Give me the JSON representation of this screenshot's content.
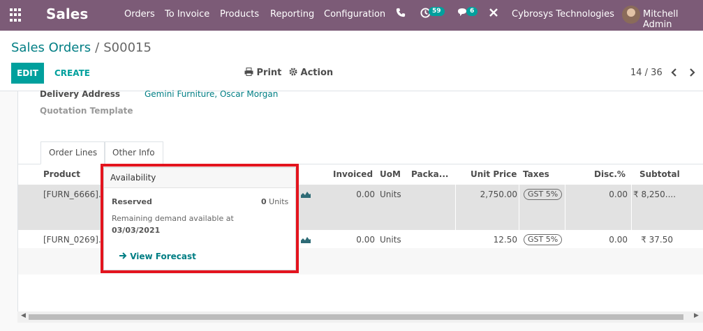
{
  "navbar": {
    "app_name": "Sales",
    "menu": [
      "Orders",
      "To Invoice",
      "Products",
      "Reporting",
      "Configuration"
    ],
    "activity_count": "59",
    "messages_count": "6",
    "company": "Cybrosys Technologies",
    "user": "Mitchell Admin"
  },
  "breadcrumb": {
    "parent": "Sales Orders",
    "separator": "/",
    "current": "S00015"
  },
  "toolbar": {
    "edit": "EDIT",
    "create": "CREATE",
    "print": "Print",
    "action": "Action",
    "pager": "14 / 36"
  },
  "form": {
    "delivery_address_label": "Delivery Address",
    "delivery_address_value": "Gemini Furniture, Oscar Morgan",
    "quotation_template_label": "Quotation Template"
  },
  "tabs": [
    "Order Lines",
    "Other Info"
  ],
  "table": {
    "columns": {
      "product": "Product",
      "invoiced": "Invoiced",
      "uom": "UoM",
      "packaging": "Packa...",
      "unit_price": "Unit Price",
      "taxes": "Taxes",
      "discount": "Disc.%",
      "subtotal": "Subtotal"
    },
    "rows": [
      {
        "product": "[FURN_6666]...",
        "invoiced": "0.00",
        "uom": "Units",
        "unit_price": "2,750.00",
        "tax": "GST 5%",
        "discount": "0.00",
        "subtotal": "₹ 8,250...."
      },
      {
        "product": "[FURN_0269]...",
        "invoiced": "0.00",
        "uom": "Units",
        "unit_price": "12.50",
        "tax": "GST 5%",
        "discount": "0.00",
        "subtotal": "₹ 37.50"
      }
    ]
  },
  "popover": {
    "title": "Availability",
    "reserved_label": "Reserved",
    "reserved_qty": "0",
    "reserved_unit": "Units",
    "remaining_text": "Remaining demand available at",
    "date": "03/03/2021",
    "link": "View Forecast"
  },
  "colors": {
    "navbar": "#7c5b77",
    "primary": "#00a09d",
    "link": "#017e84",
    "highlight": "#e3141e"
  }
}
